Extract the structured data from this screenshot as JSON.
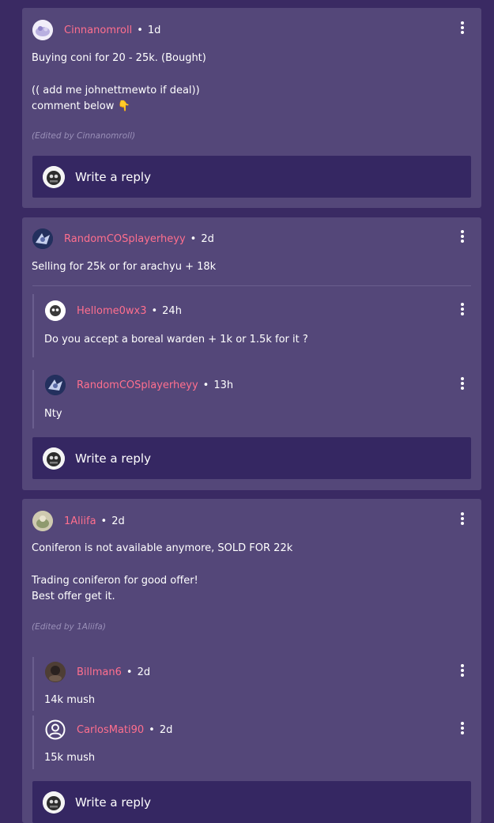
{
  "posts": [
    {
      "username": "Cinnanomroll",
      "time": "1d",
      "line1": "Buying coni for 20 - 25k. (Bought)",
      "line2": "(( add me johnettmewto if deal))",
      "line3": "comment below 👇",
      "edited": "(Edited by Cinnanomroll)",
      "reply_label": "Write a reply"
    },
    {
      "username": "RandomCOSplayerheyy",
      "time": "2d",
      "line1": "Selling for 25k or for arachyu + 18k",
      "replies": [
        {
          "username": "Hellome0wx3",
          "time": "24h",
          "text": "Do you accept a boreal warden + 1k or 1.5k for it ?"
        },
        {
          "username": "RandomCOSplayerheyy",
          "time": "13h",
          "text": "Nty"
        }
      ],
      "reply_label": "Write a reply"
    },
    {
      "username": "1Aliifa",
      "time": "2d",
      "line1": "Coniferon is not available anymore, SOLD FOR 22k",
      "line2": "Trading coniferon for good offer!",
      "line3": "Best offer get it.",
      "edited": "(Edited by 1Aliifa)",
      "replies": [
        {
          "username": "Billman6",
          "time": "2d",
          "text": "14k mush"
        },
        {
          "username": "CarlosMati90",
          "time": "2d",
          "text": "15k mush"
        }
      ],
      "reply_label": "Write a reply"
    }
  ],
  "separator": "•",
  "colors": {
    "username": "#ff6f8e",
    "card": "#544779",
    "background": "#3a2a63",
    "reply_box": "#352762"
  },
  "icons": {
    "menu": "kebab-menu-icon",
    "default_avatar": "user-circle-icon"
  }
}
